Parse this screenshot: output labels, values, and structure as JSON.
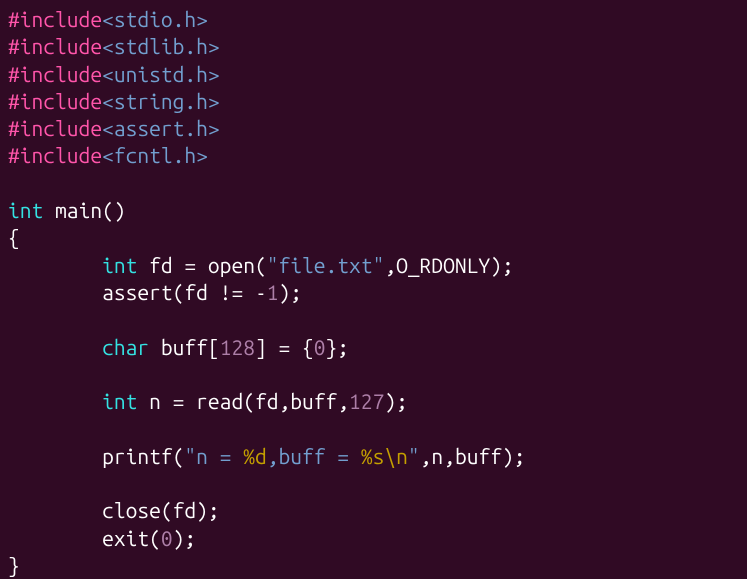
{
  "code": {
    "lines": [
      {
        "type": "include",
        "directive": "#include",
        "header": "<stdio.h>"
      },
      {
        "type": "include",
        "directive": "#include",
        "header": "<stdlib.h>"
      },
      {
        "type": "include",
        "directive": "#include",
        "header": "<unistd.h>"
      },
      {
        "type": "include",
        "directive": "#include",
        "header": "<string.h>"
      },
      {
        "type": "include",
        "directive": "#include",
        "header": "<assert.h>"
      },
      {
        "type": "include",
        "directive": "#include",
        "header": "<fcntl.h>"
      }
    ],
    "funcReturnType": "int",
    "funcName": "main",
    "funcParams": "()",
    "openBrace": "{",
    "closeBrace": "}",
    "body": {
      "l1_type": "int",
      "l1_var": " fd = open(",
      "l1_str": "\"file.txt\"",
      "l1_rest": ",O_RDONLY);",
      "l2_text": "assert(fd != -",
      "l2_num": "1",
      "l2_end": ");",
      "l3_type": "char",
      "l3_var": " buff[",
      "l3_num1": "128",
      "l3_mid": "] = {",
      "l3_num2": "0",
      "l3_end": "};",
      "l4_type": "int",
      "l4_var": " n = read(fd,buff,",
      "l4_num": "127",
      "l4_end": ");",
      "l5_func": "printf(",
      "l5_str_open": "\"n = ",
      "l5_esc1": "%d",
      "l5_str_mid": ",buff = ",
      "l5_esc2": "%s",
      "l5_esc3": "\\n",
      "l5_str_close": "\"",
      "l5_rest": ",n,buff);",
      "l6_text": "close(fd);",
      "l7_func": "exit(",
      "l7_num": "0",
      "l7_end": ");"
    }
  }
}
